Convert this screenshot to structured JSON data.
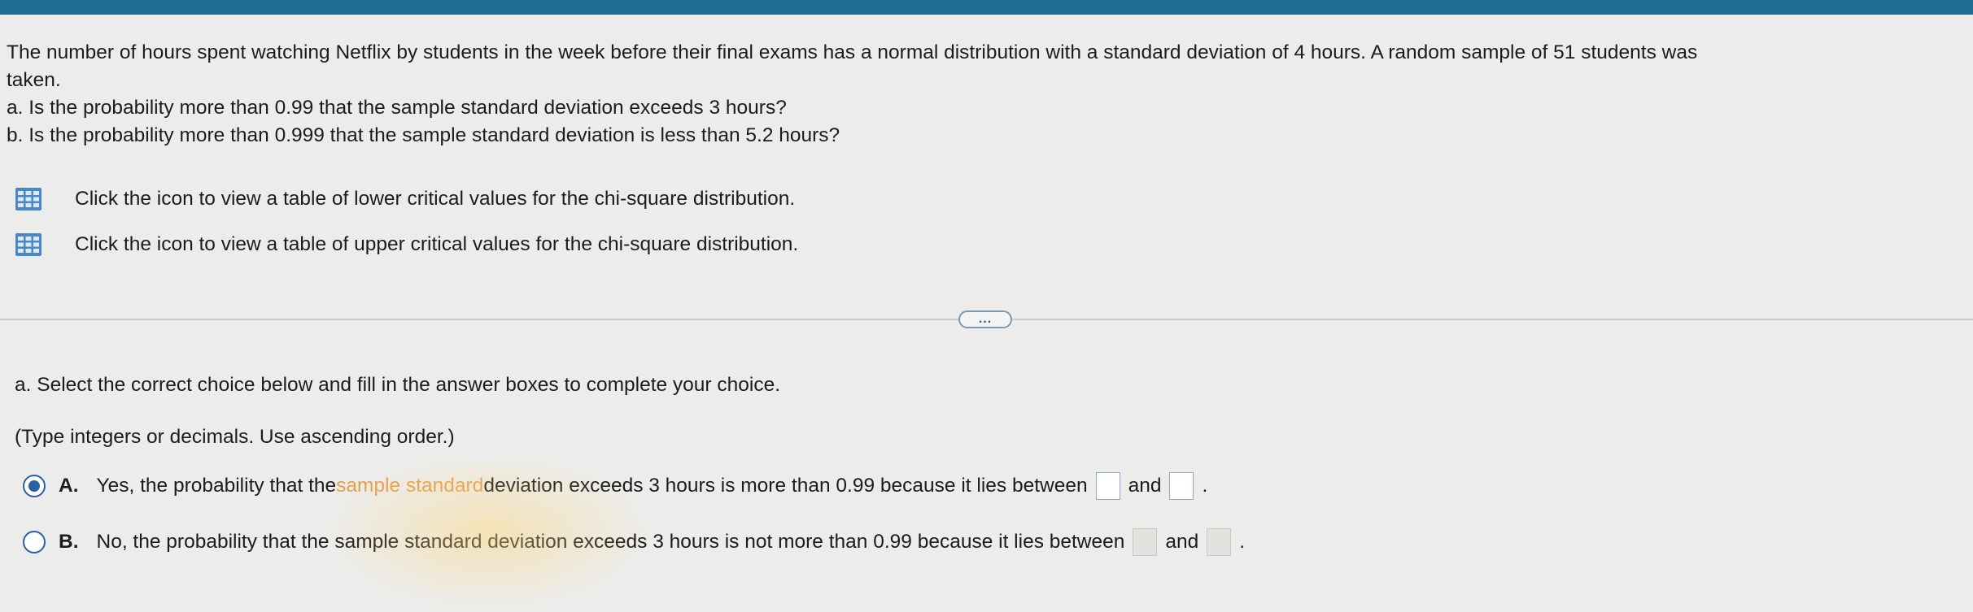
{
  "problem": {
    "intro_line1": "The number of hours spent watching Netflix by students in the week before their final exams has a normal distribution with a standard deviation of 4 hours. A random sample of 51 students was",
    "intro_line2": "taken.",
    "part_a": "a. Is the probability more than 0.99 that the sample standard deviation exceeds 3 hours?",
    "part_b": "b. Is the probability more than 0.999 that the sample standard deviation is less than 5.2 hours?"
  },
  "links": {
    "lower_table": "Click the icon to view a table of lower critical values for the chi-square distribution.",
    "upper_table": "Click the icon to view a table of upper critical values for the chi-square distribution."
  },
  "more_button": "...",
  "question": {
    "instruction": "a. Select the correct choice below and fill in the answer boxes to complete your choice.",
    "hint": "(Type integers or decimals. Use ascending order.)",
    "choice_a": {
      "letter": "A.",
      "text_before_highlight": "Yes, the probability that the ",
      "highlighted": "sample standard",
      "text_after_highlight": " deviation exceeds 3 hours is more than 0.99 because it lies between",
      "and": "and",
      "end": ".",
      "selected": true
    },
    "choice_b": {
      "letter": "B.",
      "text": "No, the probability that the sample standard deviation exceeds 3 hours is not more than 0.99 because it lies between",
      "and": "and",
      "end": ".",
      "selected": false
    }
  },
  "colors": {
    "accent": "#2b5fa8",
    "topbar": "#1f6f93"
  }
}
